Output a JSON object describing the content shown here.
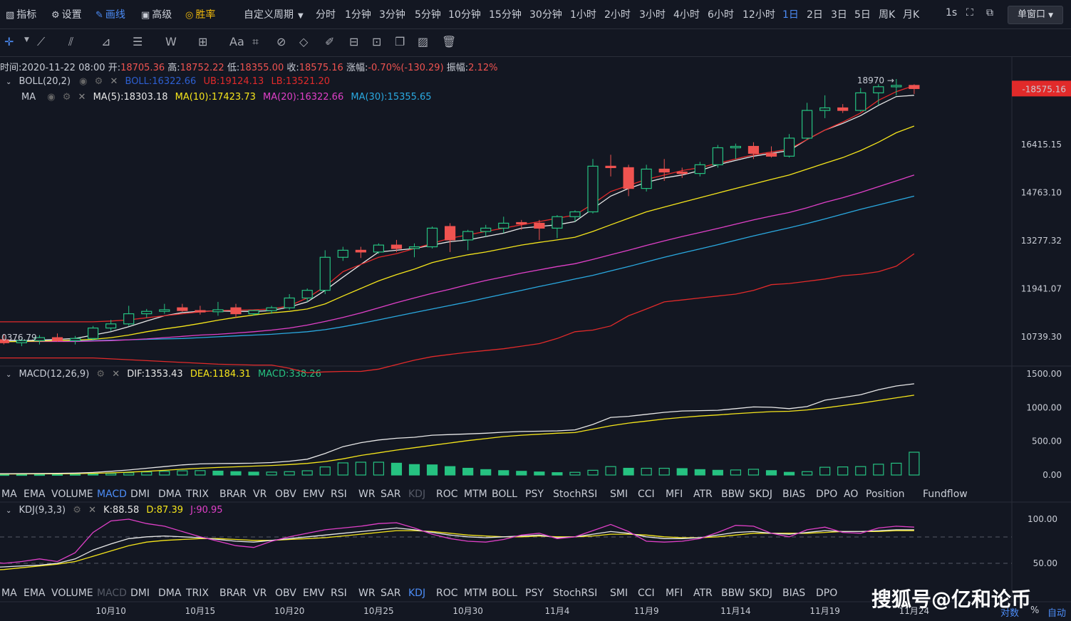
{
  "topbar": {
    "indicators": "指标",
    "settings": "设置",
    "drawing": "画线",
    "advanced": "高级",
    "winrate": "胜率",
    "custom_period": "自定义周期",
    "periods": [
      "分时",
      "1分钟",
      "3分钟",
      "5分钟",
      "10分钟",
      "15分钟",
      "30分钟",
      "1小时",
      "2小时",
      "3小时",
      "4小时",
      "6小时",
      "12小时",
      "1日",
      "2日",
      "3日",
      "5日",
      "周K",
      "月K"
    ],
    "active_period": "1日",
    "interval": "1s",
    "single_window": "单窗口"
  },
  "info": {
    "time_label": "时间:",
    "time": "2020-11-22 08:00",
    "open_label": "开:",
    "open": "18705.36",
    "high_label": "高:",
    "high": "18752.22",
    "low_label": "低:",
    "low": "18355.00",
    "close_label": "收:",
    "close": "18575.16",
    "change_label": "涨幅:",
    "change": "-0.70%(-130.29)",
    "amp_label": "振幅:",
    "amp": "2.12%"
  },
  "boll": {
    "name": "BOLL(20,2)",
    "mid": "BOLL:16322.66",
    "ub": "UB:19124.13",
    "lb": "LB:13521.20"
  },
  "ma": {
    "name": "MA",
    "ma5": "MA(5):18303.18",
    "ma10": "MA(10):17423.73",
    "ma20": "MA(20):16322.66",
    "ma30": "MA(30):15355.65"
  },
  "macd": {
    "name": "MACD(12,26,9)",
    "dif": "DIF:1353.43",
    "dea": "DEA:1184.31",
    "macd": "MACD:338.26"
  },
  "kdj": {
    "name": "KDJ(9,3,3)",
    "k": "K:88.58",
    "d": "D:87.39",
    "j": "J:90.95"
  },
  "indicator_tabs": [
    "MA",
    "EMA",
    "VOLUME",
    "MACD",
    "DMI",
    "DMA",
    "TRIX",
    "BRAR",
    "VR",
    "OBV",
    "EMV",
    "RSI",
    "WR",
    "SAR",
    "KDJ",
    "ROC",
    "MTM",
    "BOLL",
    "PSY",
    "StochRSI",
    "SMI",
    "CCI",
    "MFI",
    "ATR",
    "BBW",
    "SKDJ",
    "BIAS",
    "DPO",
    "AO",
    "Position",
    "Fundflow"
  ],
  "indicator_tabs2": [
    "MA",
    "EMA",
    "VOLUME",
    "MACD",
    "DMI",
    "DMA",
    "TRIX",
    "BRAR",
    "VR",
    "OBV",
    "EMV",
    "RSI",
    "WR",
    "SAR",
    "KDJ",
    "ROC",
    "MTM",
    "BOLL",
    "PSY",
    "StochRSI",
    "SMI",
    "CCI",
    "MFI",
    "ATR",
    "BBW",
    "SKDJ",
    "BIAS",
    "DPO"
  ],
  "bottom": {
    "log": "对数",
    "pct": "%",
    "auto": "自动"
  },
  "watermark": "搜狐号@亿和论币",
  "colors": {
    "up": "#26c281",
    "down": "#ef5350",
    "ub": "#e12a2a",
    "ma5": "#e8e8e8",
    "ma10": "#f5e51b",
    "ma20": "#e040c8",
    "ma30": "#2aa9e0",
    "dea": "#f5e51b",
    "j": "#e040c8",
    "accent": "#4c8cf6"
  },
  "chart_data": [
    {
      "type": "candlestick",
      "title": "BOLL(20,2) / MA",
      "y_ticks": [
        "16415.15",
        "14763.10",
        "13277.32",
        "11941.07",
        "10739.30"
      ],
      "ylim": [
        10100,
        19300
      ],
      "last_price": "18575.16",
      "high_marker": "18970",
      "left_edge_label": "0376.79",
      "x_labels": [
        "10月10",
        "10月15",
        "10月20",
        "10月25",
        "10月30",
        "11月4",
        "11月9",
        "11月14",
        "11月19",
        "11月24"
      ],
      "x_label_index": [
        7,
        12,
        17,
        22,
        27,
        32,
        37,
        42,
        47,
        52
      ],
      "candles": [
        {
          "o": 10600,
          "h": 10720,
          "l": 10540,
          "c": 10670
        },
        {
          "o": 10670,
          "h": 10800,
          "l": 10560,
          "c": 10600
        },
        {
          "o": 10600,
          "h": 10700,
          "l": 10520,
          "c": 10650
        },
        {
          "o": 10650,
          "h": 10780,
          "l": 10560,
          "c": 10720
        },
        {
          "o": 10720,
          "h": 10820,
          "l": 10620,
          "c": 10650
        },
        {
          "o": 10650,
          "h": 10760,
          "l": 10560,
          "c": 10700
        },
        {
          "o": 10700,
          "h": 11000,
          "l": 10650,
          "c": 10950
        },
        {
          "o": 10950,
          "h": 11150,
          "l": 10880,
          "c": 11050
        },
        {
          "o": 11050,
          "h": 11500,
          "l": 11000,
          "c": 11300
        },
        {
          "o": 11300,
          "h": 11420,
          "l": 11200,
          "c": 11360
        },
        {
          "o": 11360,
          "h": 11550,
          "l": 11300,
          "c": 11400
        },
        {
          "o": 11450,
          "h": 11550,
          "l": 11350,
          "c": 11380
        },
        {
          "o": 11380,
          "h": 11500,
          "l": 11280,
          "c": 11350
        },
        {
          "o": 11350,
          "h": 11600,
          "l": 11250,
          "c": 11400
        },
        {
          "o": 11450,
          "h": 11550,
          "l": 11200,
          "c": 11300
        },
        {
          "o": 11300,
          "h": 11400,
          "l": 11250,
          "c": 11380
        },
        {
          "o": 11380,
          "h": 11500,
          "l": 11300,
          "c": 11450
        },
        {
          "o": 11450,
          "h": 11800,
          "l": 11400,
          "c": 11700
        },
        {
          "o": 11700,
          "h": 11950,
          "l": 11600,
          "c": 11900
        },
        {
          "o": 11900,
          "h": 13000,
          "l": 11800,
          "c": 12800
        },
        {
          "o": 12800,
          "h": 13100,
          "l": 12700,
          "c": 13000
        },
        {
          "o": 13000,
          "h": 13100,
          "l": 12780,
          "c": 12950
        },
        {
          "o": 12950,
          "h": 13200,
          "l": 12900,
          "c": 13150
        },
        {
          "o": 13150,
          "h": 13300,
          "l": 12950,
          "c": 13050
        },
        {
          "o": 13050,
          "h": 13200,
          "l": 12800,
          "c": 13100
        },
        {
          "o": 13100,
          "h": 13700,
          "l": 13050,
          "c": 13650
        },
        {
          "o": 13700,
          "h": 13800,
          "l": 12950,
          "c": 13300
        },
        {
          "o": 13300,
          "h": 13600,
          "l": 13000,
          "c": 13550
        },
        {
          "o": 13550,
          "h": 13750,
          "l": 13400,
          "c": 13650
        },
        {
          "o": 13650,
          "h": 14000,
          "l": 13500,
          "c": 13800
        },
        {
          "o": 13820,
          "h": 13900,
          "l": 13600,
          "c": 13800
        },
        {
          "o": 13800,
          "h": 13900,
          "l": 13300,
          "c": 13650
        },
        {
          "o": 13650,
          "h": 14050,
          "l": 13350,
          "c": 14000
        },
        {
          "o": 14000,
          "h": 14200,
          "l": 13850,
          "c": 14150
        },
        {
          "o": 14150,
          "h": 15900,
          "l": 14100,
          "c": 15650
        },
        {
          "o": 15650,
          "h": 16050,
          "l": 15300,
          "c": 15600
        },
        {
          "o": 15600,
          "h": 15700,
          "l": 14650,
          "c": 14900
        },
        {
          "o": 14900,
          "h": 15700,
          "l": 14800,
          "c": 15550
        },
        {
          "o": 15550,
          "h": 15900,
          "l": 15150,
          "c": 15450
        },
        {
          "o": 15450,
          "h": 15600,
          "l": 15250,
          "c": 15400
        },
        {
          "o": 15400,
          "h": 15800,
          "l": 15300,
          "c": 15700
        },
        {
          "o": 15700,
          "h": 16400,
          "l": 15600,
          "c": 16300
        },
        {
          "o": 16300,
          "h": 16450,
          "l": 15900,
          "c": 16350
        },
        {
          "o": 16350,
          "h": 16500,
          "l": 15900,
          "c": 16100
        },
        {
          "o": 16100,
          "h": 16350,
          "l": 15950,
          "c": 16000
        },
        {
          "o": 16000,
          "h": 16800,
          "l": 15950,
          "c": 16650
        },
        {
          "o": 16650,
          "h": 18000,
          "l": 16600,
          "c": 17700
        },
        {
          "o": 17700,
          "h": 18300,
          "l": 17400,
          "c": 17800
        },
        {
          "o": 17800,
          "h": 17950,
          "l": 17600,
          "c": 17700
        },
        {
          "o": 17700,
          "h": 18600,
          "l": 17650,
          "c": 18400
        },
        {
          "o": 18400,
          "h": 18750,
          "l": 17900,
          "c": 18650
        },
        {
          "o": 18650,
          "h": 18970,
          "l": 18300,
          "c": 18705
        },
        {
          "o": 18705,
          "h": 18752,
          "l": 18355,
          "c": 18575
        }
      ],
      "ub": [
        11100,
        11100,
        11100,
        11100,
        11100,
        11100,
        11100,
        11120,
        11150,
        11200,
        11250,
        11300,
        11350,
        11380,
        11390,
        11400,
        11420,
        11500,
        11700,
        12000,
        12400,
        12600,
        12800,
        12900,
        13050,
        13200,
        13350,
        13450,
        13550,
        13650,
        13750,
        13850,
        13950,
        14050,
        14400,
        14800,
        15000,
        15200,
        15350,
        15500,
        15600,
        15750,
        15900,
        16050,
        16150,
        16250,
        16600,
        16950,
        17250,
        17600,
        18100,
        18450,
        18700
      ],
      "ma5": [
        10650,
        10660,
        10650,
        10660,
        10680,
        10700,
        10780,
        10860,
        10980,
        11120,
        11250,
        11330,
        11360,
        11370,
        11360,
        11360,
        11380,
        11470,
        11600,
        11900,
        12250,
        12600,
        12950,
        13000,
        13050,
        13150,
        13250,
        13300,
        13400,
        13500,
        13650,
        13700,
        13750,
        13850,
        14250,
        14650,
        14900,
        15100,
        15250,
        15350,
        15500,
        15700,
        15850,
        16000,
        16100,
        16200,
        16600,
        16950,
        17200,
        17500,
        17900,
        18250,
        18300
      ],
      "ma10": [
        10620,
        10625,
        10630,
        10640,
        10650,
        10660,
        10680,
        10720,
        10780,
        10860,
        10930,
        10990,
        11060,
        11140,
        11210,
        11270,
        11320,
        11360,
        11420,
        11550,
        11750,
        11950,
        12150,
        12320,
        12470,
        12650,
        12770,
        12870,
        12950,
        13050,
        13150,
        13230,
        13300,
        13380,
        13550,
        13750,
        13950,
        14150,
        14300,
        14450,
        14600,
        14750,
        14900,
        15050,
        15200,
        15350,
        15550,
        15750,
        15950,
        16200,
        16500,
        16850,
        17100
      ],
      "ma20": [
        10630,
        10630,
        10630,
        10630,
        10630,
        10630,
        10640,
        10650,
        10670,
        10690,
        10720,
        10750,
        10780,
        10800,
        10830,
        10860,
        10900,
        10950,
        11020,
        11110,
        11210,
        11320,
        11450,
        11580,
        11700,
        11820,
        11930,
        12050,
        12160,
        12260,
        12360,
        12450,
        12540,
        12620,
        12740,
        12870,
        13000,
        13140,
        13270,
        13400,
        13520,
        13640,
        13770,
        13900,
        14020,
        14130,
        14280,
        14450,
        14600,
        14770,
        14960,
        15150,
        15350
      ],
      "ma30": [
        10650,
        10650,
        10650,
        10650,
        10650,
        10650,
        10650,
        10660,
        10670,
        10680,
        10690,
        10700,
        10720,
        10740,
        10760,
        10780,
        10800,
        10830,
        10860,
        10910,
        10980,
        11060,
        11150,
        11240,
        11330,
        11420,
        11510,
        11600,
        11700,
        11800,
        11900,
        12000,
        12100,
        12200,
        12300,
        12420,
        12540,
        12670,
        12800,
        12920,
        13040,
        13160,
        13290,
        13420,
        13540,
        13660,
        13790,
        13930,
        14080,
        14230,
        14370,
        14510,
        14650
      ],
      "lb": [
        10250,
        10250,
        10250,
        10250,
        10250,
        10250,
        10250,
        10230,
        10210,
        10190,
        10170,
        10150,
        10130,
        10110,
        10100,
        10090,
        10090,
        10020,
        9920,
        9940,
        9950,
        9950,
        10000,
        10100,
        10200,
        10280,
        10330,
        10380,
        10420,
        10460,
        10520,
        10580,
        10700,
        10860,
        10900,
        11000,
        11250,
        11420,
        11600,
        11650,
        11700,
        11750,
        11800,
        11900,
        12050,
        12080,
        12140,
        12200,
        12290,
        12330,
        12400,
        12550,
        12900
      ]
    },
    {
      "type": "macd",
      "title": "MACD(12,26,9)",
      "y_ticks": [
        "1500.00",
        "1000.00",
        "500.00",
        "0.00"
      ],
      "ylim": [
        -50,
        1550
      ],
      "dif": [
        20,
        20,
        21,
        22,
        24,
        28,
        38,
        55,
        75,
        100,
        125,
        150,
        165,
        170,
        172,
        175,
        185,
        205,
        235,
        320,
        420,
        480,
        520,
        545,
        560,
        590,
        600,
        610,
        620,
        635,
        645,
        650,
        655,
        670,
        750,
        855,
        870,
        900,
        930,
        950,
        955,
        960,
        985,
        1010,
        1005,
        985,
        1015,
        1110,
        1150,
        1190,
        1265,
        1320,
        1353
      ],
      "dea": [
        15,
        15,
        16,
        17,
        18,
        20,
        25,
        32,
        42,
        55,
        70,
        87,
        100,
        112,
        122,
        132,
        142,
        155,
        172,
        200,
        240,
        290,
        330,
        370,
        405,
        440,
        475,
        510,
        540,
        570,
        590,
        605,
        620,
        630,
        680,
        730,
        770,
        800,
        830,
        855,
        875,
        890,
        910,
        925,
        940,
        945,
        965,
        995,
        1030,
        1065,
        1105,
        1145,
        1184
      ],
      "hist": [
        5,
        5,
        5,
        5,
        6,
        8,
        13,
        23,
        33,
        45,
        55,
        63,
        65,
        58,
        50,
        43,
        43,
        50,
        63,
        120,
        180,
        190,
        190,
        175,
        155,
        150,
        125,
        100,
        80,
        65,
        55,
        45,
        35,
        40,
        70,
        125,
        100,
        100,
        100,
        95,
        80,
        70,
        75,
        85,
        65,
        40,
        50,
        115,
        120,
        125,
        160,
        175,
        338
      ]
    },
    {
      "type": "kdj",
      "title": "KDJ(9,3,3)",
      "y_ticks": [
        "100.00",
        "50.00"
      ],
      "ylim": [
        30,
        110
      ],
      "k": [
        45,
        46,
        47,
        48,
        50,
        55,
        65,
        72,
        78,
        80,
        81,
        80,
        79,
        77,
        75,
        74,
        76,
        78,
        80,
        82,
        84,
        86,
        88,
        90,
        88,
        85,
        82,
        80,
        79,
        80,
        81,
        82,
        79,
        80,
        83,
        86,
        84,
        80,
        78,
        78,
        79,
        82,
        85,
        86,
        84,
        83,
        85,
        87,
        86,
        86,
        87,
        88,
        88
      ],
      "d": [
        42,
        43,
        45,
        47,
        49,
        52,
        58,
        64,
        70,
        74,
        76,
        77,
        78,
        78,
        77,
        76,
        76,
        77,
        78,
        79,
        81,
        83,
        85,
        87,
        87,
        86,
        84,
        82,
        81,
        80,
        80,
        81,
        80,
        80,
        81,
        83,
        83,
        82,
        80,
        79,
        79,
        80,
        82,
        84,
        84,
        84,
        84,
        85,
        86,
        86,
        86,
        87,
        87
      ],
      "j": [
        52,
        50,
        52,
        55,
        52,
        62,
        85,
        98,
        100,
        95,
        92,
        86,
        80,
        75,
        70,
        68,
        75,
        80,
        84,
        88,
        90,
        92,
        95,
        96,
        90,
        83,
        78,
        75,
        74,
        77,
        82,
        84,
        78,
        80,
        87,
        94,
        86,
        75,
        74,
        75,
        78,
        85,
        93,
        92,
        84,
        80,
        88,
        91,
        85,
        84,
        90,
        92,
        91
      ]
    }
  ]
}
